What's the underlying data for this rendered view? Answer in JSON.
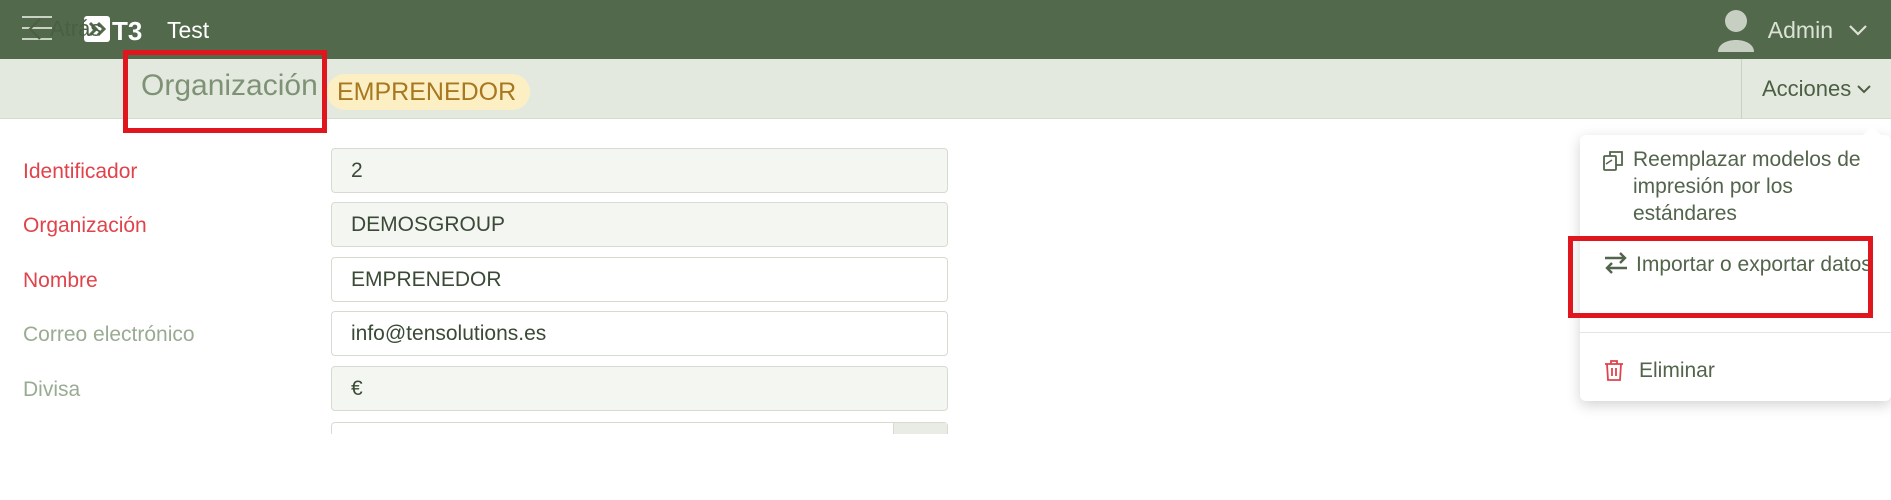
{
  "app": {
    "title": "Test",
    "logo_text": "T3",
    "user_name": "Admin"
  },
  "colors": {
    "topbar": "#53694b",
    "subbar": "#e4e9df",
    "required_label": "#e0434b",
    "optional_label": "#9aab93",
    "badge_bg": "#fdefc4",
    "badge_text": "#a87820",
    "highlight": "#e0161f"
  },
  "subheader": {
    "back_label": "Atrás",
    "page_title": "Organización",
    "badge": "EMPRENEDOR",
    "actions_label": "Acciones"
  },
  "form": {
    "fields": [
      {
        "label": "Identificador",
        "value": "2",
        "required": true
      },
      {
        "label": "Organización",
        "value": "DEMOSGROUP",
        "required": true
      },
      {
        "label": "Nombre",
        "value": "EMPRENEDOR",
        "required": true
      },
      {
        "label": "Correo electrónico",
        "value": "info@tensolutions.es",
        "required": false
      },
      {
        "label": "Divisa",
        "value": "€",
        "required": false
      }
    ]
  },
  "actions_menu": {
    "items": [
      {
        "label": "Reemplazar modelos de impresión por los estándares",
        "icon": "copy-icon"
      },
      {
        "label": "Importar o exportar datos",
        "icon": "import-export-icon"
      },
      {
        "label": "Eliminar",
        "icon": "trash-icon"
      }
    ]
  }
}
